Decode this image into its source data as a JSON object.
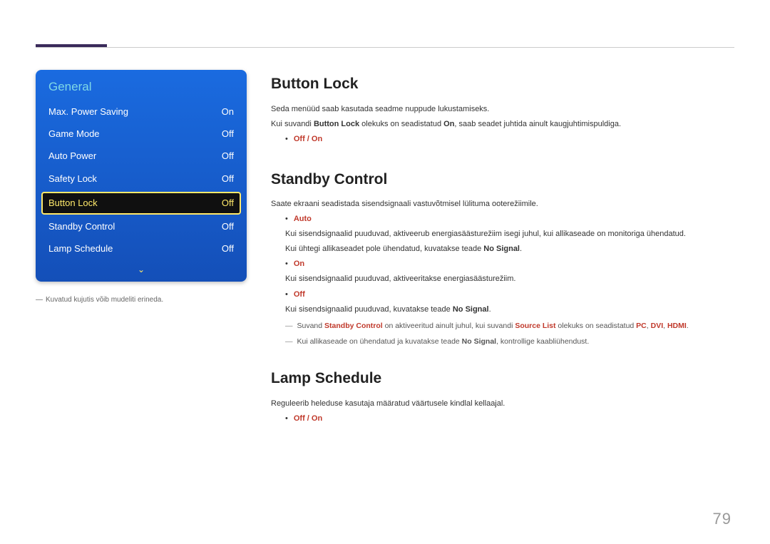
{
  "osd": {
    "title": "General",
    "rows": [
      {
        "label": "Max. Power Saving",
        "value": "On"
      },
      {
        "label": "Game Mode",
        "value": "Off"
      },
      {
        "label": "Auto Power",
        "value": "Off"
      },
      {
        "label": "Safety Lock",
        "value": "Off"
      },
      {
        "label": "Button Lock",
        "value": "Off"
      },
      {
        "label": "Standby Control",
        "value": "Off"
      },
      {
        "label": "Lamp Schedule",
        "value": "Off"
      }
    ],
    "down_arrow": "⌄"
  },
  "osd_footnote": {
    "dash": "―",
    "text": "Kuvatud kujutis võib mudeliti erineda."
  },
  "sec_button_lock": {
    "title": "Button Lock",
    "p1": "Seda menüüd saab kasutada seadme nuppude lukustamiseks.",
    "p2_a": "Kui suvandi ",
    "p2_b": "Button Lock",
    "p2_c": " olekuks on seadistatud ",
    "p2_d": "On",
    "p2_e": ", saab seadet juhtida ainult kaugjuhtimispuldiga.",
    "opt": "Off / On"
  },
  "sec_standby": {
    "title": "Standby Control",
    "p1": "Saate ekraani seadistada sisendsignaali vastuvõtmisel lülituma ooterežiimile.",
    "auto_label": "Auto",
    "auto_l1": "Kui sisendsignaalid puuduvad, aktiveerub energiasäästurežiim isegi juhul, kui allikaseade on monitoriga ühendatud.",
    "auto_l2_a": "Kui ühtegi allikaseadet pole ühendatud, kuvatakse teade ",
    "auto_l2_b": "No Signal",
    "auto_l2_c": ".",
    "on_label": "On",
    "on_l1": "Kui sisendsignaalid puuduvad, aktiveeritakse energiasäästurežiim.",
    "off_label": "Off",
    "off_l1_a": "Kui sisendsignaalid puuduvad, kuvatakse teade ",
    "off_l1_b": "No Signal",
    "off_l1_c": ".",
    "note1_a": "Suvand ",
    "note1_b": "Standby Control",
    "note1_c": " on aktiveeritud ainult juhul, kui suvandi ",
    "note1_d": "Source List",
    "note1_e": " olekuks on seadistatud ",
    "note1_f": "PC",
    "note1_g": ", ",
    "note1_h": "DVI",
    "note1_i": ", ",
    "note1_j": "HDMI",
    "note1_k": ".",
    "note2_a": "Kui allikaseade on ühendatud ja kuvatakse teade ",
    "note2_b": "No Signal",
    "note2_c": ", kontrollige kaabliühendust.",
    "dash": "―"
  },
  "sec_lamp": {
    "title": "Lamp Schedule",
    "p1": "Reguleerib heleduse kasutaja määratud väärtusele kindlal kellaajal.",
    "opt": "Off / On"
  },
  "page_number": "79"
}
